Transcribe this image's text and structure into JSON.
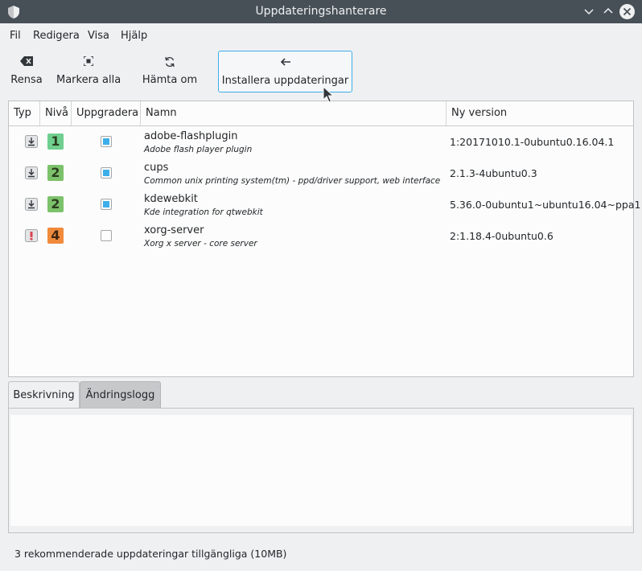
{
  "window": {
    "title": "Uppdateringshanterare",
    "app_icon": "shield-icon",
    "controls": [
      "minimize-icon",
      "maximize-icon",
      "close-icon"
    ]
  },
  "menu": [
    "Fil",
    "Redigera",
    "Visa",
    "Hjälp"
  ],
  "toolbar": {
    "clear": {
      "label": "Rensa",
      "icon": "clear-icon"
    },
    "select_all": {
      "label": "Markera alla",
      "icon": "select-all-icon"
    },
    "refresh": {
      "label": "Hämta om",
      "icon": "refresh-icon"
    },
    "install": {
      "label": "Installera uppdateringar",
      "icon": "arrow-left-icon"
    }
  },
  "table": {
    "headers": [
      "Typ",
      "Nivå",
      "Uppgradera",
      "Namn",
      "Ny version"
    ],
    "rows": [
      {
        "type": "download",
        "level": "1",
        "level_color": "#6fcf8f",
        "upgrade": true,
        "name": "adobe-flashplugin",
        "description": "Adobe flash player plugin",
        "version": "1:20171010.1-0ubuntu0.16.04.1"
      },
      {
        "type": "download",
        "level": "2",
        "level_color": "#7cc26b",
        "upgrade": true,
        "name": "cups",
        "description": "Common unix printing system(tm) - ppd/driver support, web interface",
        "version": "2.1.3-4ubuntu0.3"
      },
      {
        "type": "download",
        "level": "2",
        "level_color": "#7cc26b",
        "upgrade": true,
        "name": "kdewebkit",
        "description": "Kde integration for qtwebkit",
        "version": "5.36.0-0ubuntu1~ubuntu16.04~ppa1"
      },
      {
        "type": "critical",
        "level": "4",
        "level_color": "#f08a3c",
        "upgrade": false,
        "name": "xorg-server",
        "description": "Xorg x server - core server",
        "version": "2:1.18.4-0ubuntu0.6"
      }
    ]
  },
  "tabs": [
    "Beskrivning",
    "Ändringslogg"
  ],
  "status": "3 rekommenderade uppdateringar tillgängliga (10MB)",
  "colors": {
    "titlebar": "#475057",
    "accent": "#3daee9",
    "critical": "#da4453"
  }
}
